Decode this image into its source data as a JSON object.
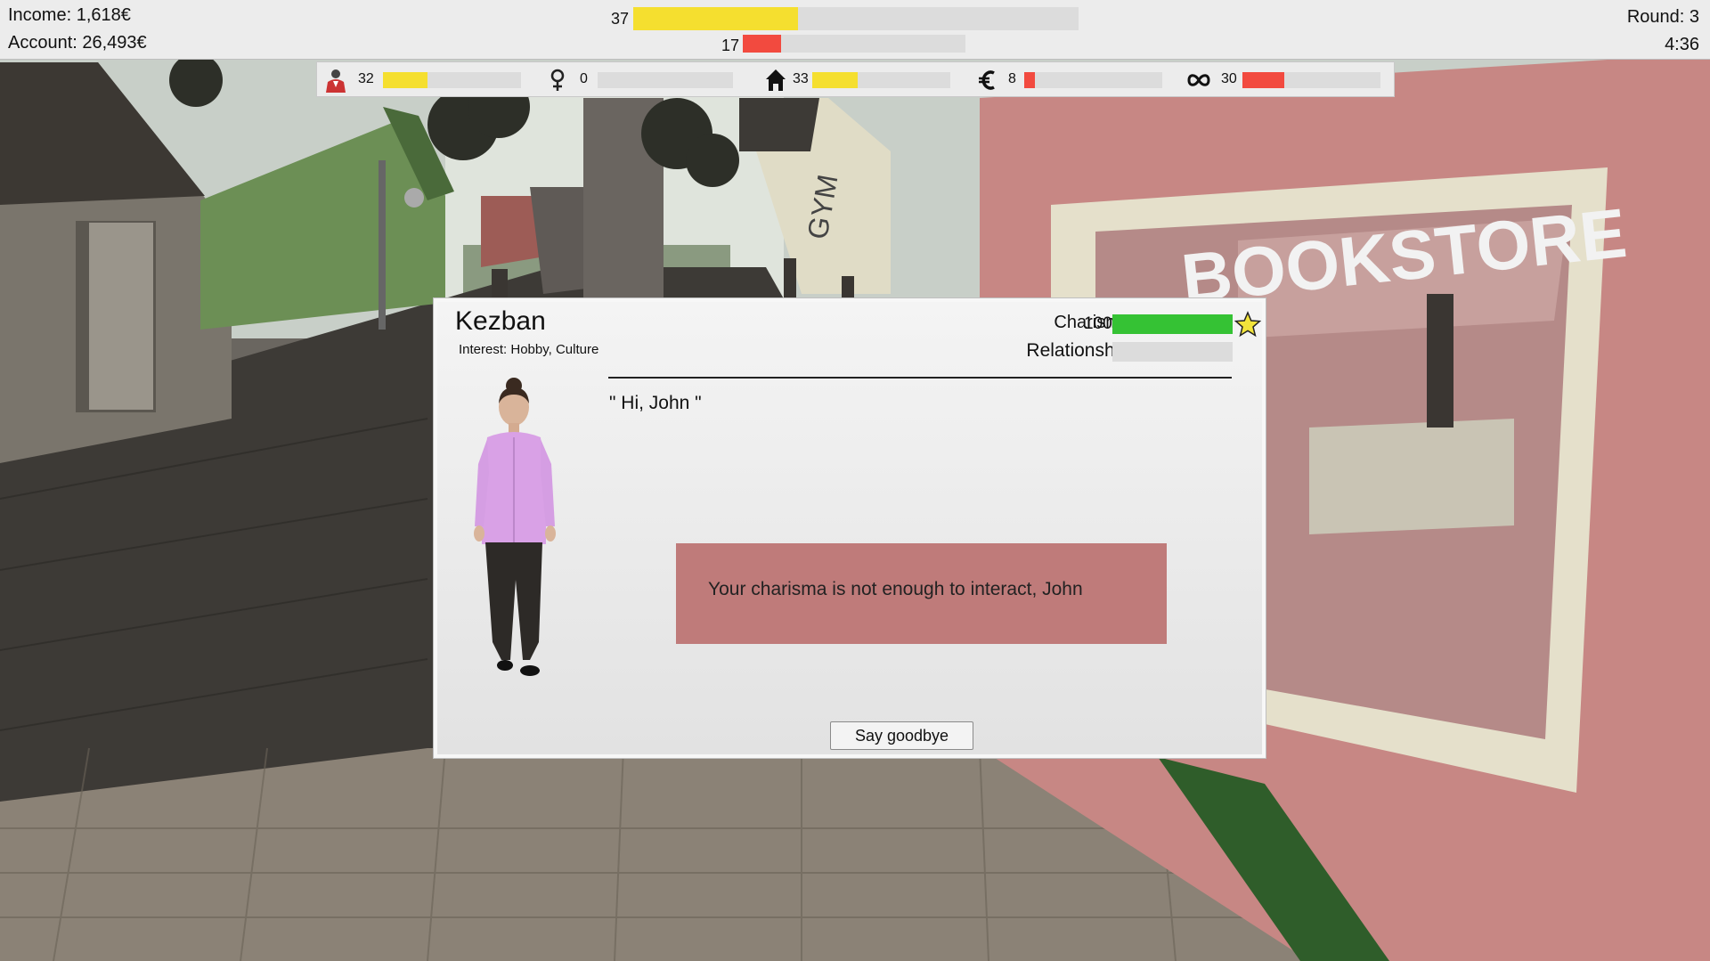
{
  "hud": {
    "income_label": "Income: 1,618€",
    "account_label": "Account: 26,493€",
    "round_label": "Round:  3",
    "timer": "4:36",
    "main_bars": [
      {
        "value": "37",
        "fill": 0.37,
        "color": "#f5df2f"
      },
      {
        "value": "17",
        "fill": 0.17,
        "color": "#f24a3f"
      }
    ]
  },
  "stats": [
    {
      "icon": "person-icon",
      "value": "32",
      "fill": 0.32,
      "color": "#f5df2f"
    },
    {
      "icon": "female-symbol-icon",
      "value": "0",
      "fill": 0.0,
      "color": "#f5df2f"
    },
    {
      "icon": "house-icon",
      "value": "33",
      "fill": 0.33,
      "color": "#f5df2f"
    },
    {
      "icon": "euro-icon",
      "value": "8",
      "fill": 0.08,
      "color": "#f24a3f"
    },
    {
      "icon": "infinity-icon",
      "value": "30",
      "fill": 0.3,
      "color": "#f24a3f"
    }
  ],
  "dialog": {
    "npc_name": "Kezban",
    "interest": "Interest: Hobby, Culture",
    "charisma_label": "Charisma",
    "charisma_value": "100",
    "charisma_fill": 1.0,
    "charisma_color": "#35c234",
    "relationship_label": "Relationship",
    "relationship_value": "0",
    "relationship_fill": 0.0,
    "greeting": "\" Hi, John \"",
    "warning": "Your charisma is not enough to interact, John",
    "goodbye_label": "Say goodbye"
  },
  "scene_signs": {
    "bookstore": "BOOKSTORE",
    "gym": "GYM"
  }
}
